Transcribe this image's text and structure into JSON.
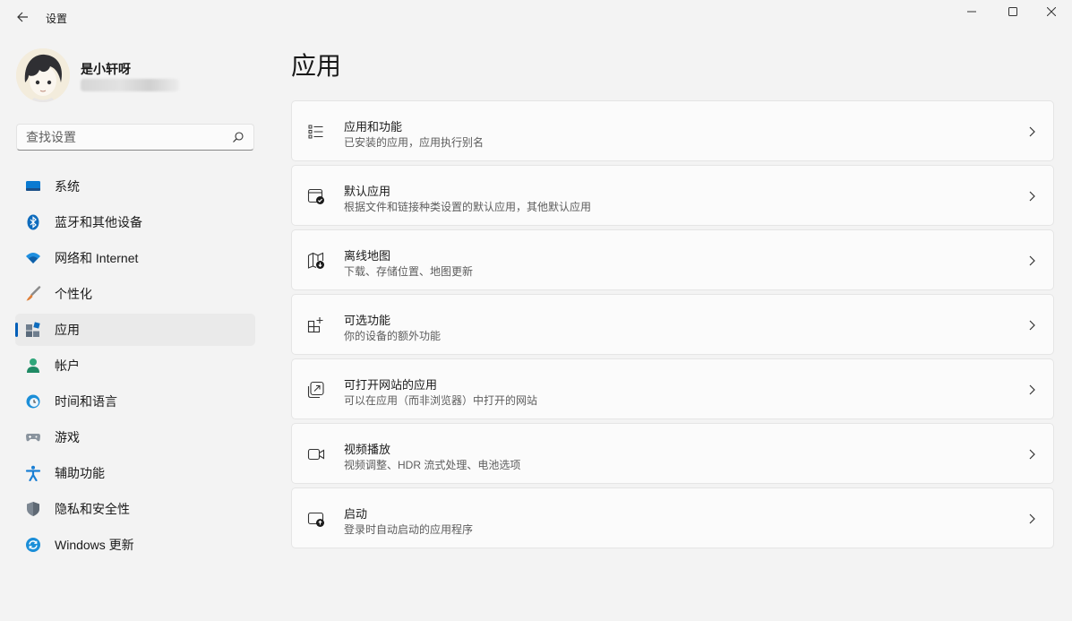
{
  "window": {
    "title": "设置",
    "controls": [
      "minimize-icon",
      "maximize-icon",
      "close-icon"
    ]
  },
  "profile": {
    "name": "是小轩呀"
  },
  "search": {
    "placeholder": "查找设置",
    "icon": "search-icon"
  },
  "sidebar": {
    "items": [
      {
        "label": "系统",
        "icon": "monitor-icon",
        "selected": false
      },
      {
        "label": "蓝牙和其他设备",
        "icon": "bluetooth-icon",
        "selected": false
      },
      {
        "label": "网络和 Internet",
        "icon": "wifi-icon",
        "selected": false
      },
      {
        "label": "个性化",
        "icon": "brush-icon",
        "selected": false
      },
      {
        "label": "应用",
        "icon": "apps-icon",
        "selected": true
      },
      {
        "label": "帐户",
        "icon": "person-icon",
        "selected": false
      },
      {
        "label": "时间和语言",
        "icon": "globe-clock-icon",
        "selected": false
      },
      {
        "label": "游戏",
        "icon": "gamepad-icon",
        "selected": false
      },
      {
        "label": "辅助功能",
        "icon": "accessibility-icon",
        "selected": false
      },
      {
        "label": "隐私和安全性",
        "icon": "shield-icon",
        "selected": false
      },
      {
        "label": "Windows 更新",
        "icon": "update-icon",
        "selected": false
      }
    ]
  },
  "main": {
    "title": "应用",
    "cards": [
      {
        "title": "应用和功能",
        "subtitle": "已安装的应用，应用执行别名",
        "icon": "list-icon"
      },
      {
        "title": "默认应用",
        "subtitle": "根据文件和链接种类设置的默认应用，其他默认应用",
        "icon": "default-app-icon"
      },
      {
        "title": "离线地图",
        "subtitle": "下载、存储位置、地图更新",
        "icon": "offline-map-icon"
      },
      {
        "title": "可选功能",
        "subtitle": "你的设备的额外功能",
        "icon": "add-feature-icon"
      },
      {
        "title": "可打开网站的应用",
        "subtitle": "可以在应用（而非浏览器）中打开的网站",
        "icon": "open-link-icon"
      },
      {
        "title": "视频播放",
        "subtitle": "视频调整、HDR 流式处理、电池选项",
        "icon": "video-icon"
      },
      {
        "title": "启动",
        "subtitle": "登录时自动启动的应用程序",
        "icon": "startup-icon"
      }
    ]
  },
  "colors": {
    "background": "#f3f3f3",
    "card": "#fbfbfb",
    "accent": "#005fb8",
    "selected_nav": "#eaeaea"
  }
}
